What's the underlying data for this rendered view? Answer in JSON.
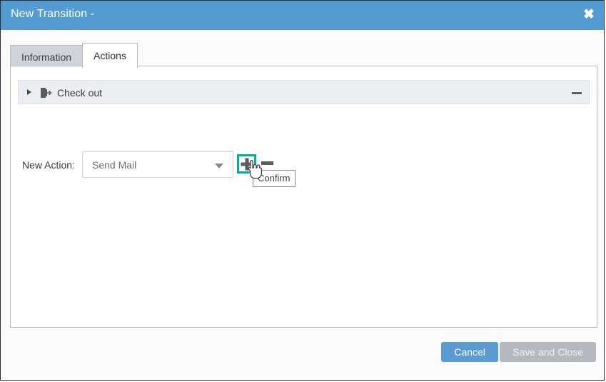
{
  "window": {
    "title": "New Transition -",
    "close_icon": "close-icon"
  },
  "tabs": [
    {
      "label": "Information",
      "active": false
    },
    {
      "label": "Actions",
      "active": true
    }
  ],
  "section": {
    "title": "Check out",
    "expand_arrow_icon": "chevron-right-icon",
    "type_icon": "check-out-door-icon",
    "collapse_icon": "minus-icon"
  },
  "form": {
    "action_label": "New Action:",
    "action_select_value": "Send Mail",
    "action_select_arrow_icon": "chevron-down-icon",
    "add_icon": "plus-icon",
    "remove_icon": "minus-icon"
  },
  "tooltip": {
    "text": "Confirm"
  },
  "cursor": {
    "icon": "pointing-hand-cursor"
  },
  "footer": {
    "cancel_label": "Cancel",
    "save_close_label": "Save and Close"
  },
  "colors": {
    "titlebar": "#529cd2",
    "highlight": "#00b295",
    "primary_button": "#5b9bd5",
    "disabled_button": "#b4b9bf",
    "section_header": "#eaedf1"
  }
}
